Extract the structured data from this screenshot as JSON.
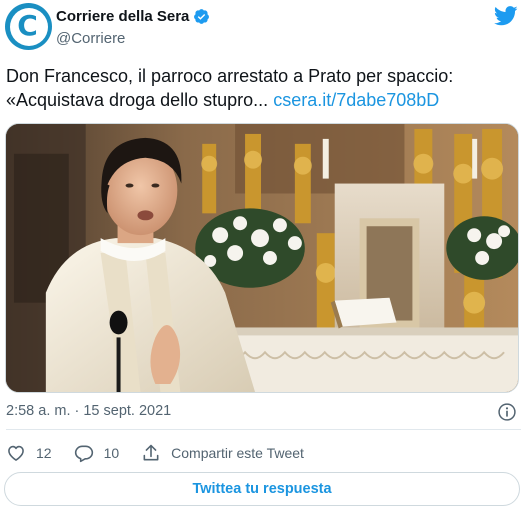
{
  "tweet": {
    "author": {
      "display_name": "Corriere della Sera",
      "handle": "@Corriere",
      "verified": true,
      "avatar_icon": "corriere-c-logo-icon",
      "avatar_letter": "C",
      "brand_color": "#1a8fc2"
    },
    "text_line1": "Don Francesco, il parroco arrestato a Prato per spaccio:",
    "text_line2": "«Acquistava droga dello stupro...",
    "link_text": "csera.it/7dabe708bD",
    "image": {
      "description_icon": "priest-at-altar-photo"
    },
    "timestamp": "2:58 a. m. · 15 sept. 2021",
    "likes": "12",
    "replies": "10",
    "share_label": "Compartir este Tweet",
    "reply_button_label": "Twittea tu respuesta",
    "accent_color": "#1b95e0"
  }
}
